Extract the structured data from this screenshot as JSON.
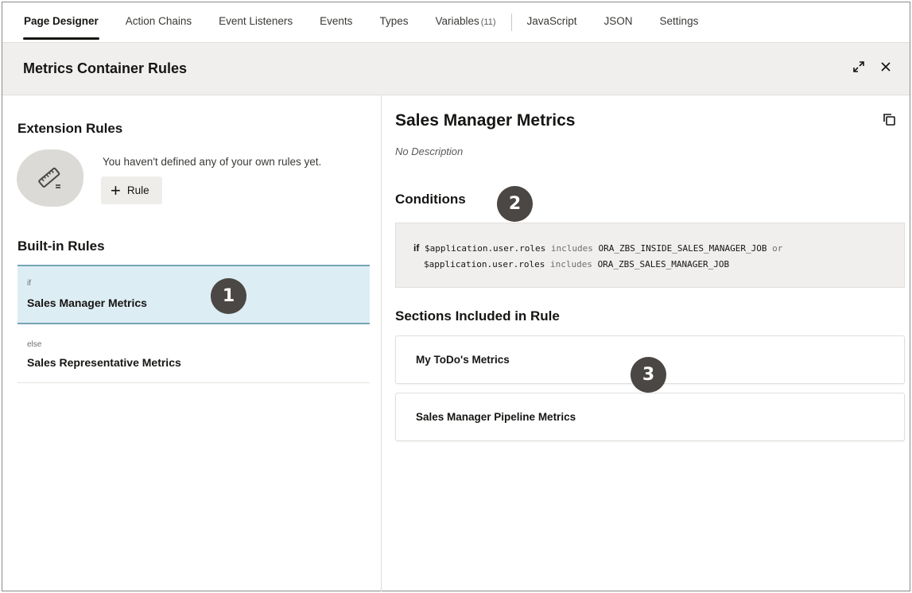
{
  "tabs": [
    {
      "label": "Page Designer"
    },
    {
      "label": "Action Chains"
    },
    {
      "label": "Event Listeners"
    },
    {
      "label": "Events"
    },
    {
      "label": "Types"
    },
    {
      "label": "Variables",
      "count": "(11)"
    },
    {
      "label": "JavaScript"
    },
    {
      "label": "JSON"
    },
    {
      "label": "Settings"
    }
  ],
  "header": {
    "title": "Metrics Container Rules",
    "expand_icon": "expand-icon",
    "close_icon": "close-icon"
  },
  "left": {
    "extension_title": "Extension Rules",
    "empty_message": "You haven't defined any of your own rules yet.",
    "add_rule_label": "Rule",
    "builtin_title": "Built-in Rules",
    "rules": [
      {
        "keyword": "if",
        "name": "Sales Manager Metrics"
      },
      {
        "keyword": "else",
        "name": "Sales Representative Metrics"
      }
    ]
  },
  "right": {
    "title": "Sales Manager Metrics",
    "description": "No Description",
    "conditions_title": "Conditions",
    "condition": {
      "if_kw": "if",
      "line1_var": "$application.user.roles",
      "line1_op": "includes",
      "line1_val": "ORA_ZBS_INSIDE_SALES_MANAGER_JOB",
      "or_kw": "or",
      "line2_var": "$application.user.roles",
      "line2_op": "includes",
      "line2_val": "ORA_ZBS_SALES_MANAGER_JOB"
    },
    "sections_title": "Sections Included in Rule",
    "sections": [
      "My ToDo's Metrics",
      "Sales Manager Pipeline Metrics"
    ]
  },
  "callouts": [
    "1",
    "2",
    "3"
  ],
  "colors": {
    "selected_bg": "#ddedf4",
    "selected_border": "#76a4b7",
    "badge": "#4a4744",
    "header_bg": "#f1efed"
  }
}
